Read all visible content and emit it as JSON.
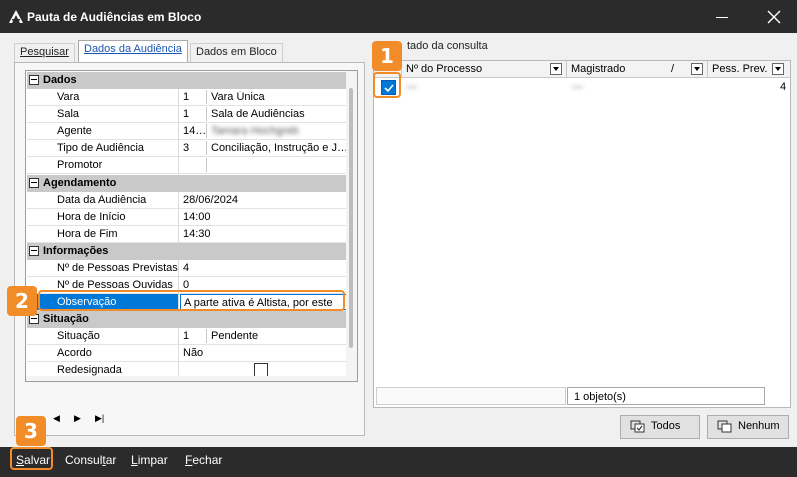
{
  "window": {
    "title": "Pauta de Audiências em Bloco"
  },
  "tabs": [
    {
      "label": "Pesquisar"
    },
    {
      "label": "Dados da Audiência"
    },
    {
      "label": "Dados em Bloco"
    }
  ],
  "property_grid": {
    "categories": [
      {
        "title": "Dados",
        "rows": [
          {
            "name": "Vara",
            "code": "1",
            "desc": "Vara Única"
          },
          {
            "name": "Sala",
            "code": "1",
            "desc": "Sala de Audiências"
          },
          {
            "name": "Agente",
            "code": "14…",
            "desc": "Tamara Hochgreb"
          },
          {
            "name": "Tipo de Audiência",
            "code": "3",
            "desc": "Conciliação, Instrução e J…"
          },
          {
            "name": "Promotor",
            "code": "",
            "desc": ""
          }
        ]
      },
      {
        "title": "Agendamento",
        "rows": [
          {
            "name": "Data da Audiência",
            "value": "28/06/2024"
          },
          {
            "name": "Hora de Início",
            "value": "14:00"
          },
          {
            "name": "Hora de Fim",
            "value": "14:30"
          }
        ]
      },
      {
        "title": "Informações",
        "rows": [
          {
            "name": "Nº de Pessoas Previstas",
            "value": "4"
          },
          {
            "name": "Nº de Pessoas Ouvidas",
            "value": "0"
          },
          {
            "name": "Observação",
            "value": "A parte ativa é Altista, por este"
          }
        ]
      },
      {
        "title": "Situação",
        "rows": [
          {
            "name": "Situação",
            "code": "1",
            "desc": "Pendente"
          },
          {
            "name": "Acordo",
            "value": "Não"
          },
          {
            "name": "Redesignada",
            "value": ""
          }
        ]
      }
    ]
  },
  "results": {
    "label": "Resultado da consulta",
    "label_visible": "tado da consulta",
    "columns": [
      {
        "label": "Nº do Processo"
      },
      {
        "label": "Magistrado"
      },
      {
        "label": "Pess. Prev."
      }
    ],
    "rows": [
      {
        "checked": true,
        "processo": "—",
        "magistrado": "—",
        "pess_prev": "4"
      }
    ],
    "status": "1 objeto(s)",
    "sort_indicator": "/"
  },
  "actions": {
    "todos": "Todos",
    "nenhum": "Nenhum"
  },
  "nav": {
    "prev": "◀",
    "next": "▶",
    "last": "▶|"
  },
  "bottom_bar": {
    "salvar": {
      "u": "S",
      "rest": "alvar"
    },
    "consultar": {
      "pre": "Consul",
      "u": "t",
      "rest": "ar"
    },
    "limpar": {
      "u": "L",
      "rest": "impar"
    },
    "fechar": {
      "u": "F",
      "rest": "echar"
    }
  },
  "callouts": [
    "1",
    "2",
    "3"
  ],
  "colors": {
    "titlebar": "#2b2b2b",
    "accent": "#0078d7",
    "callout": "#f28c28",
    "category_bg": "#c9c9c9"
  }
}
